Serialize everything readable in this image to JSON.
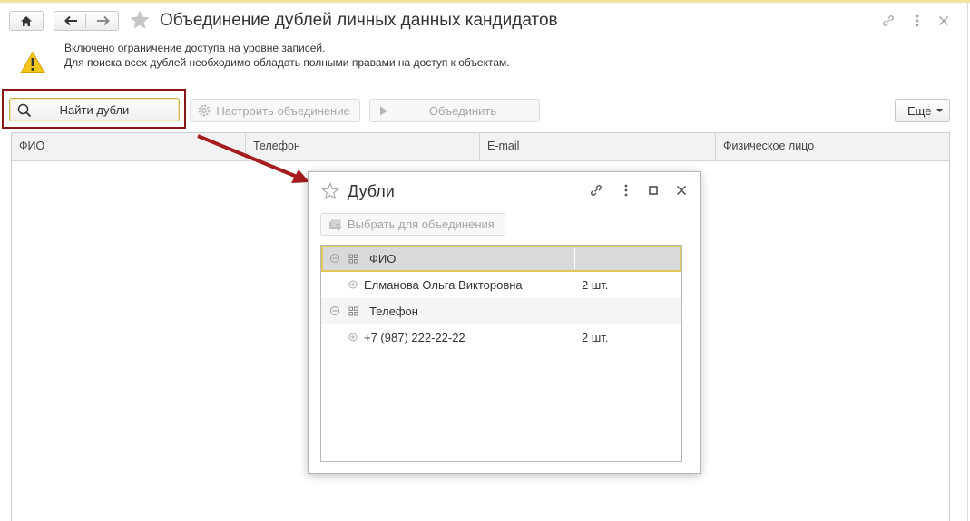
{
  "window": {
    "title": "Объединение дублей личных данных кандидатов"
  },
  "warning": {
    "line1": "Включено ограничение доступа на уровне записей.",
    "line2": "Для поиска всех дублей необходимо обладать полными правами на доступ к объектам."
  },
  "toolbar": {
    "find_label": "Найти дубли",
    "configure_label": "Настроить объединение",
    "merge_label": "Объединить",
    "more_label": "Еще"
  },
  "table": {
    "columns": [
      "ФИО",
      "Телефон",
      "E-mail",
      "Физическое лицо"
    ]
  },
  "dialog": {
    "title": "Дубли",
    "select_label": "Выбрать для объединения",
    "groups": [
      {
        "name": "ФИО",
        "items": [
          {
            "value": "Елманова Ольга Викторовна",
            "count": "2 шт."
          }
        ]
      },
      {
        "name": "Телефон",
        "items": [
          {
            "value": "+7 (987) 222-22-22",
            "count": "2 шт."
          }
        ]
      }
    ]
  },
  "colors": {
    "accent_red": "#a51d1d",
    "selection_border": "#e2c85a",
    "warning_yellow": "#f5c61a"
  }
}
